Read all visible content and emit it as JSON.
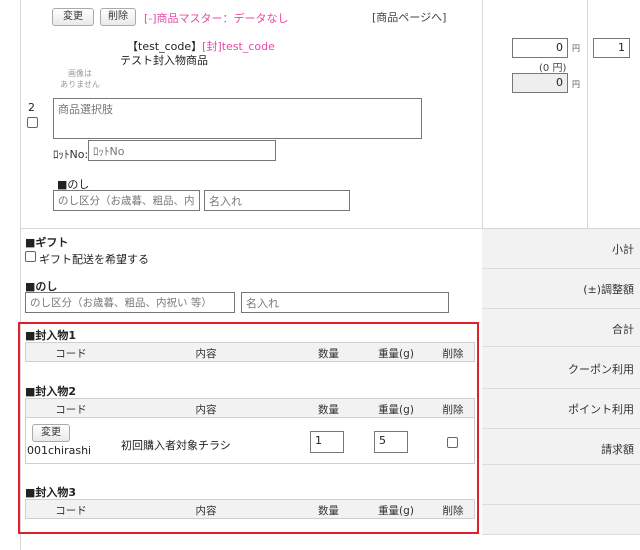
{
  "product": {
    "change_label": "変更",
    "delete_label": "削除",
    "master_link": "[-]商品マスター：データなし",
    "product_page_link": "[商品ページへ]",
    "code_bracket": "【test_code】",
    "code_pink": "[封]test_code",
    "product_name": "テスト封入物商品",
    "no_image": "画像は\nありません",
    "row_number": "2",
    "option_placeholder": "商品選択肢",
    "lot_label": "ﾛｯﾄNo:",
    "lot_placeholder": "ﾛｯﾄNo",
    "noshi_title": "■のし",
    "noshi_placeholder": "のし区分（お歳暮、粗品、内",
    "name_placeholder": "名入れ",
    "price_value": "0",
    "yen": "円",
    "tax_value": "(0 円)",
    "gray_value": "0",
    "qty_value": "1"
  },
  "gift": {
    "title": "■ギフト",
    "checkbox_label": "ギフト配送を希望する"
  },
  "noshi2": {
    "title": "■のし",
    "placeholder": "のし区分（お歳暮、粗品、内祝い 等）",
    "name_placeholder": "名入れ"
  },
  "enclosures": {
    "headers": {
      "code": "コード",
      "content": "内容",
      "qty": "数量",
      "weight": "重量(g)",
      "delete": "削除"
    },
    "sec1_title": "■封入物1",
    "sec2_title": "■封入物2",
    "sec3_title": "■封入物3",
    "row": {
      "change_label": "変更",
      "code": "001chirashi",
      "content": "初回購入者対象チラシ",
      "qty": "1",
      "weight": "5"
    }
  },
  "summary": {
    "subtotal": "小計",
    "adjustment": "(±)調整額",
    "total": "合計",
    "coupon": "クーポン利用",
    "point": "ポイント利用",
    "billing": "請求額"
  },
  "colors": {
    "highlight_border": "#e0202a",
    "pink_text": "#e54aa6"
  }
}
